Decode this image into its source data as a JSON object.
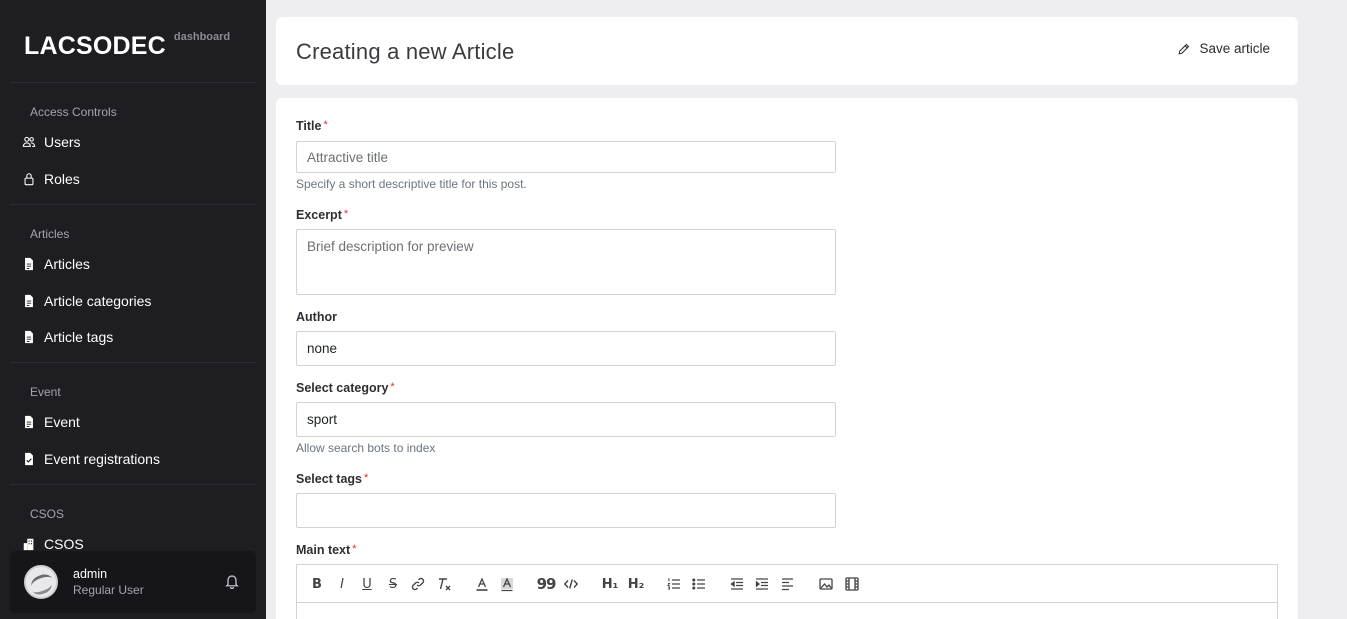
{
  "brand": {
    "name": "LACSODEC",
    "sub": "dashboard"
  },
  "sidebar": {
    "sections": [
      {
        "title": "Access Controls",
        "items": [
          {
            "label": "Users",
            "icon": "users-icon"
          },
          {
            "label": "Roles",
            "icon": "lock-icon"
          }
        ]
      },
      {
        "title": "Articles",
        "items": [
          {
            "label": "Articles",
            "icon": "document-icon"
          },
          {
            "label": "Article categories",
            "icon": "document-icon"
          },
          {
            "label": "Article tags",
            "icon": "document-icon"
          }
        ]
      },
      {
        "title": "Event",
        "items": [
          {
            "label": "Event",
            "icon": "document-icon"
          },
          {
            "label": "Event registrations",
            "icon": "document-check-icon"
          }
        ]
      },
      {
        "title": "CSOS",
        "items": [
          {
            "label": "CSOS",
            "icon": "building-icon"
          }
        ]
      }
    ]
  },
  "user": {
    "name": "admin",
    "role": "Regular User"
  },
  "header": {
    "title": "Creating a new Article",
    "save_label": "Save article"
  },
  "form": {
    "title": {
      "label": "Title",
      "required": "*",
      "placeholder": "Attractive title",
      "help": "Specify a short descriptive title for this post."
    },
    "excerpt": {
      "label": "Excerpt",
      "required": "*",
      "placeholder": "Brief description for preview"
    },
    "author": {
      "label": "Author",
      "value": "none"
    },
    "category": {
      "label": "Select category",
      "required": "*",
      "value": "sport",
      "help": "Allow search bots to index"
    },
    "tags": {
      "label": "Select tags",
      "required": "*",
      "value": ""
    },
    "main_text": {
      "label": "Main text",
      "required": "*"
    }
  },
  "toolbar": {
    "bold": "B",
    "italic": "I",
    "underline": "U",
    "strike": "S",
    "h1": "H₁",
    "h2": "H₂",
    "quote": "99"
  },
  "colors": {
    "sidebar_bg": "#1d1d22",
    "page_bg": "#eeeef0",
    "required": "#e03131"
  }
}
